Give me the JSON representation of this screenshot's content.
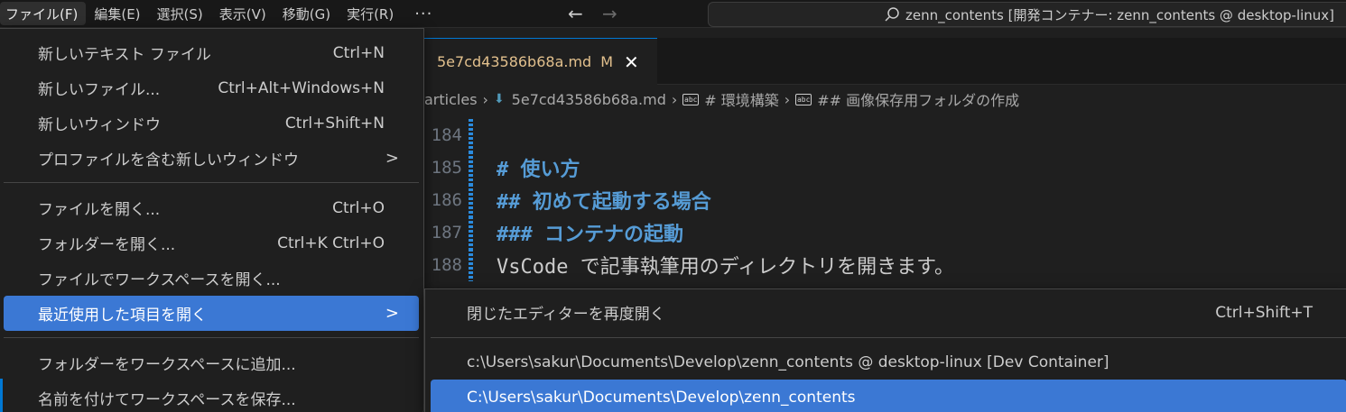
{
  "menubar": {
    "items": [
      {
        "label": "ファイル(F)",
        "active": true
      },
      {
        "label": "編集(E)"
      },
      {
        "label": "選択(S)"
      },
      {
        "label": "表示(V)"
      },
      {
        "label": "移動(G)"
      },
      {
        "label": "実行(R)"
      }
    ],
    "more_label": "···",
    "back_icon": "arrow-left-icon",
    "forward_icon": "arrow-right-icon"
  },
  "command_center": {
    "text": "zenn_contents [開発コンテナー: zenn_contents @ desktop-linux]",
    "icon": "search-icon"
  },
  "tab": {
    "filename": "5e7cd43586b68a.md",
    "status": "M",
    "close_icon": "close-icon"
  },
  "breadcrumb": {
    "items": [
      "articles",
      "5e7cd43586b68a.md",
      "# 環境構築",
      "## 画像保存用フォルダの作成"
    ]
  },
  "editor": {
    "lines": [
      {
        "number": "184",
        "text": ""
      },
      {
        "number": "185",
        "text": "# 使い方"
      },
      {
        "number": "186",
        "text": "## 初めて起動する場合"
      },
      {
        "number": "187",
        "text": "### コンテナの起動"
      },
      {
        "number": "188",
        "text": "VsCode で記事執筆用のディレクトリを開きます。"
      }
    ]
  },
  "file_menu": {
    "items": [
      {
        "label": "新しいテキスト ファイル",
        "shortcut": "Ctrl+N"
      },
      {
        "label": "新しいファイル...",
        "shortcut": "Ctrl+Alt+Windows+N"
      },
      {
        "label": "新しいウィンドウ",
        "shortcut": "Ctrl+Shift+N"
      },
      {
        "label": "プロファイルを含む新しいウィンドウ",
        "shortcut": "",
        "submenu": true
      },
      {
        "label": "ファイルを開く...",
        "shortcut": "Ctrl+O"
      },
      {
        "label": "フォルダーを開く...",
        "shortcut": "Ctrl+K Ctrl+O"
      },
      {
        "label": "ファイルでワークスペースを開く...",
        "shortcut": ""
      },
      {
        "label": "最近使用した項目を開く",
        "shortcut": "",
        "submenu": true,
        "highlight": true
      },
      {
        "label": "フォルダーをワークスペースに追加...",
        "shortcut": ""
      },
      {
        "label": "名前を付けてワークスペースを保存...",
        "shortcut": ""
      }
    ],
    "submenu_arrow": ">"
  },
  "recent_menu": {
    "items": [
      {
        "label": "閉じたエディターを再度開く",
        "shortcut": "Ctrl+Shift+T"
      },
      {
        "label": "c:\\Users\\sakur\\Documents\\Develop\\zenn_contents @ desktop-linux [Dev Container]",
        "shortcut": ""
      },
      {
        "label": "C:\\Users\\sakur\\Documents\\Develop\\zenn_contents",
        "shortcut": "",
        "highlight": true
      }
    ]
  },
  "colors": {
    "accent": "#3b78d4",
    "heading": "#569cd6",
    "modified": "#e2c08d"
  }
}
